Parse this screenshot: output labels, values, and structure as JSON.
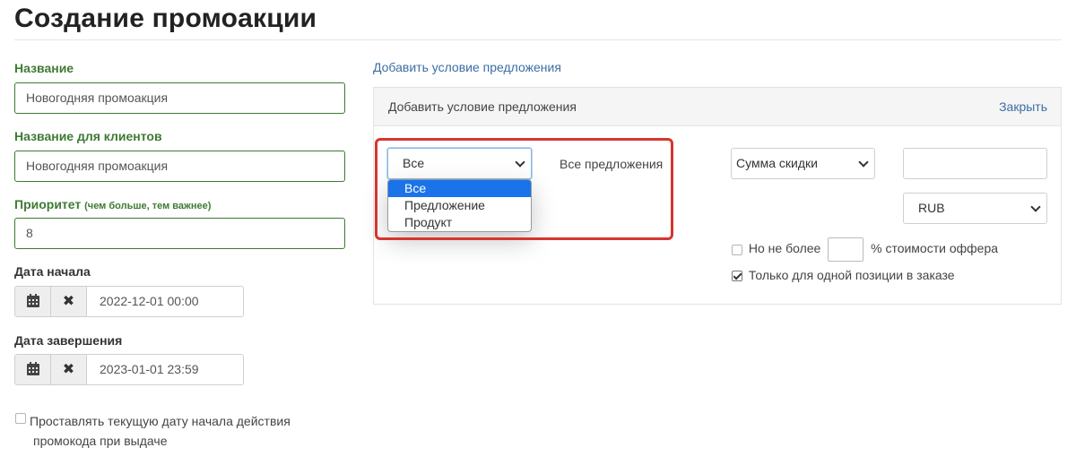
{
  "page": {
    "title": "Создание промоакции"
  },
  "form": {
    "name": {
      "label": "Название",
      "value": "Новогодняя промоакция"
    },
    "client_name": {
      "label": "Название для клиентов",
      "value": "Новогодняя промоакция"
    },
    "priority": {
      "label": "Приоритет",
      "hint": "(чем больше, тем важнее)",
      "value": "8"
    },
    "start_date": {
      "label": "Дата начала",
      "value": "2022-12-01 00:00"
    },
    "end_date": {
      "label": "Дата завершения",
      "value": "2023-01-01 23:59"
    },
    "set_current_date": {
      "label_line1": "Проставлять текущую дату начала действия",
      "label_line2": "промокода при выдаче",
      "checked": false
    }
  },
  "offer_condition": {
    "add_link": "Добавить условие предложения",
    "panel_title": "Добавить условие предложения",
    "close_label": "Закрыть",
    "scope_select": {
      "value": "Все",
      "options": [
        "Все",
        "Предложение",
        "Продукт"
      ],
      "highlighted": "Все"
    },
    "scope_text": "Все предложения",
    "discount_type_select": {
      "value": "Сумма скидки"
    },
    "discount_amount": {
      "value": ""
    },
    "currency_select": {
      "value": "RUB"
    },
    "max_percent": {
      "prefix": "Но не более",
      "suffix": "% стоимости оффера",
      "value": "",
      "checked": false
    },
    "single_position": {
      "label": "Только для одной позиции в заказе",
      "checked": true
    }
  },
  "colors": {
    "label_green": "#3e7a33",
    "link_blue": "#3b6ea5",
    "highlight_red": "#d8342f",
    "option_active": "#1a73e8"
  }
}
